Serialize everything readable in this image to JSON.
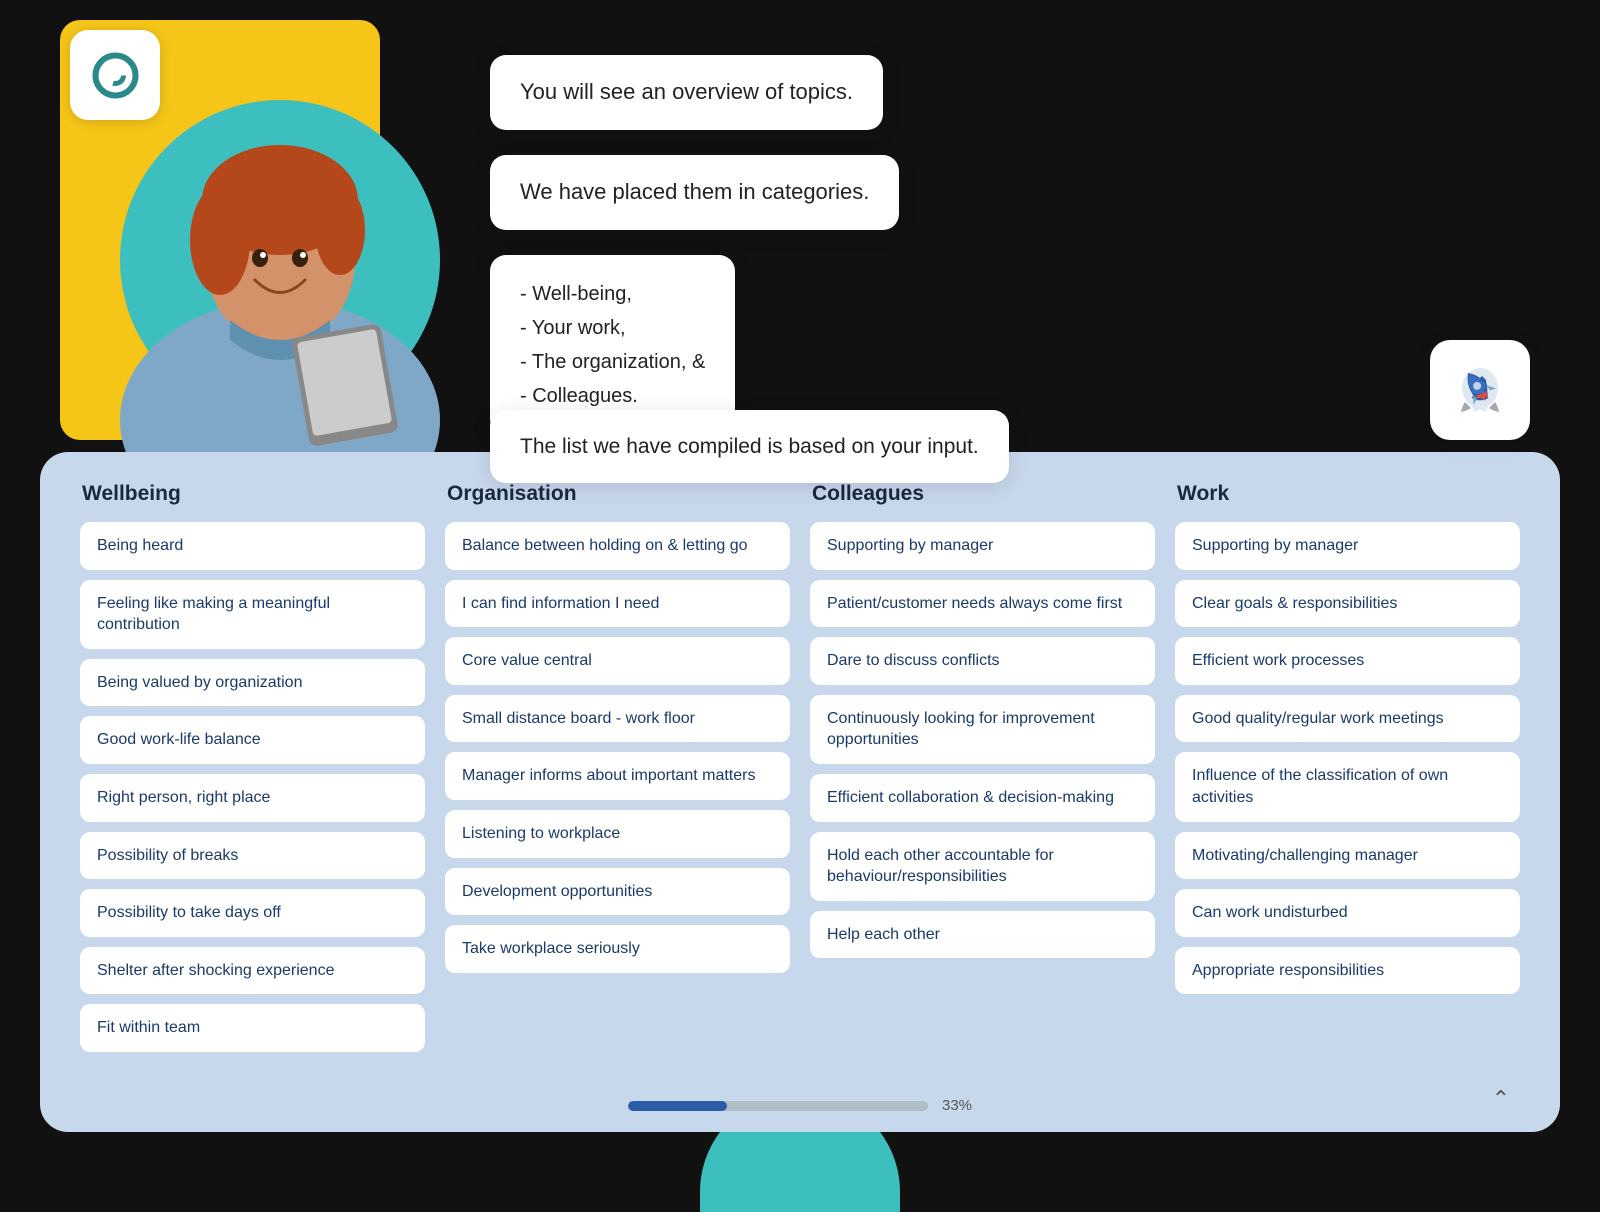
{
  "logo": {
    "alt": "App logo"
  },
  "bubbles": {
    "b1": "You will see an overview of topics.",
    "b2": "We have placed them in categories.",
    "b3": "- Well-being,\n- Your work,\n- The organization, &\n- Colleagues.",
    "b4": "The list we have compiled is based on your input."
  },
  "columns": [
    {
      "id": "wellbeing",
      "header": "Wellbeing",
      "items": [
        "Being heard",
        "Feeling like making a meaningful contribution",
        "Being valued by organization",
        "Good work-life balance",
        "Right person, right place",
        "Possibility of breaks",
        "Possibility to take days off",
        "Shelter after shocking experience",
        "Fit within team"
      ]
    },
    {
      "id": "organisation",
      "header": "Organisation",
      "items": [
        "Balance between holding on & letting go",
        "I can find information I need",
        "Core value central",
        "Small distance board - work floor",
        "Manager informs about important matters",
        "Listening to workplace",
        "Development opportunities",
        "Take workplace seriously"
      ]
    },
    {
      "id": "colleagues",
      "header": "Colleagues",
      "items": [
        "Supporting by manager",
        "Patient/customer needs always come first",
        "Dare to discuss conflicts",
        "Continuously looking for improvement opportunities",
        "Efficient collaboration & decision-making",
        "Hold each other accountable for behaviour/responsibilities",
        "Help each other"
      ]
    },
    {
      "id": "work",
      "header": "Work",
      "items": [
        "Supporting by manager",
        "Clear goals & responsibilities",
        "Efficient work processes",
        "Good quality/regular work meetings",
        "Influence of the classification of own activities",
        "Motivating/challenging manager",
        "Can work undisturbed",
        "Appropriate responsibilities"
      ]
    }
  ],
  "progress": {
    "percent": 33,
    "label": "33%"
  }
}
